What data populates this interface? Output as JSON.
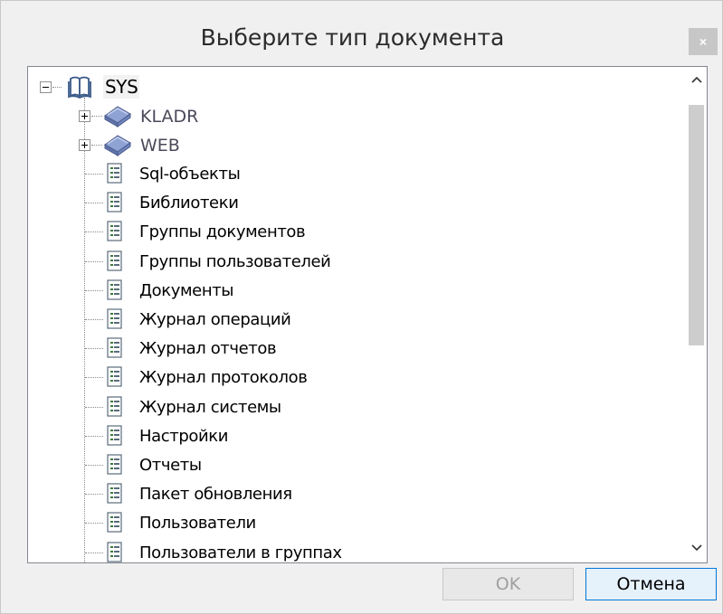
{
  "window": {
    "title": "Выберите тип документа",
    "close_label": "×"
  },
  "tree": {
    "root": {
      "label": "SYS",
      "expanded": true,
      "icon": "book-icon"
    },
    "databases": [
      {
        "label": "KLADR",
        "expanded": false,
        "icon": "database-icon"
      },
      {
        "label": "WEB",
        "expanded": false,
        "icon": "database-icon"
      }
    ],
    "tables": [
      "Sql-объекты",
      "Библиотеки",
      "Группы документов",
      "Группы пользователей",
      "Документы",
      "Журнал операций",
      "Журнал отчетов",
      "Журнал протоколов",
      "Журнал системы",
      "Настройки",
      "Отчеты",
      "Пакет обновления",
      "Пользователи",
      "Пользователи в группах"
    ]
  },
  "buttons": {
    "ok": {
      "label": "OK",
      "enabled": false
    },
    "cancel": {
      "label": "Отмена",
      "enabled": true
    }
  },
  "colors": {
    "accent": "#0078d7",
    "database_icon": "#6a7fb5"
  }
}
